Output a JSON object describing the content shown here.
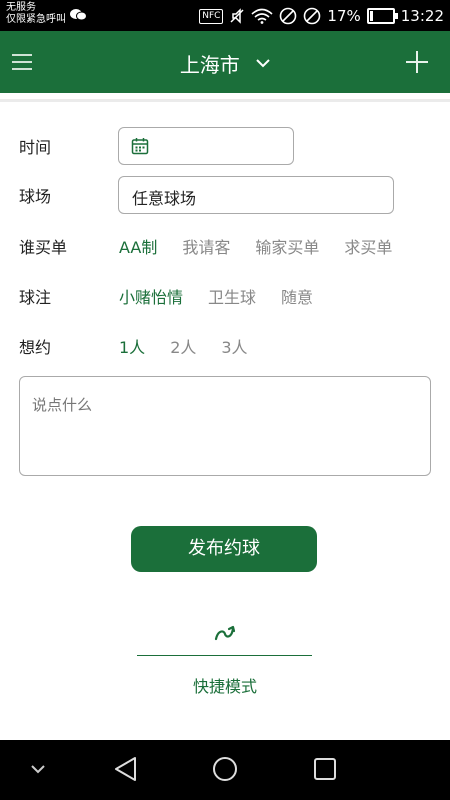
{
  "status_bar": {
    "carrier_line1": "无服务",
    "carrier_line2": "仅限紧急呼叫",
    "nfc": "NFC",
    "battery_percent": "17%",
    "battery_level": 0.17,
    "time": "13:22"
  },
  "header": {
    "city": "上海市",
    "menu_icon": "menu-icon",
    "add_icon": "plus-icon"
  },
  "form": {
    "time_label": "时间",
    "time_value": "",
    "court_label": "球场",
    "court_value": "任意球场",
    "payer_label": "谁买单",
    "payer_options": [
      "AA制",
      "我请客",
      "输家买单",
      "求买单"
    ],
    "payer_selected": 0,
    "stake_label": "球注",
    "stake_options": [
      "小赌怡情",
      "卫生球",
      "随意"
    ],
    "stake_selected": 0,
    "people_label": "想约",
    "people_options": [
      "1人",
      "2人",
      "3人"
    ],
    "people_selected": 0,
    "comment_placeholder": "说点什么"
  },
  "actions": {
    "publish_label": "发布约球",
    "quick_mode_label": "快捷模式"
  },
  "colors": {
    "brand": "#1b6f3a",
    "inactive_text": "#888888"
  }
}
